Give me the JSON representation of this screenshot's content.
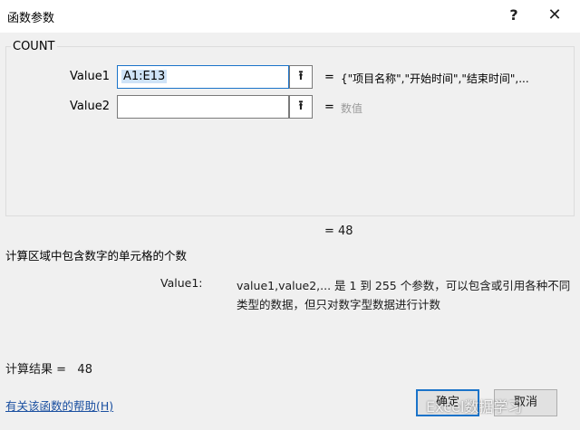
{
  "window": {
    "title": "函数参数",
    "help_glyph": "?",
    "close_glyph": "✕"
  },
  "function_name": "COUNT",
  "args": [
    {
      "label": "Value1",
      "value": "A1:E13",
      "preview": "{\"项目名称\",\"开始时间\",\"结束时间\",..."
    },
    {
      "label": "Value2",
      "value": "",
      "preview": "数值"
    }
  ],
  "equals_sign": "=",
  "collapse_glyph": "⭱",
  "formula_result": "= 48",
  "description": "计算区域中包含数字的单元格的个数",
  "param_help": {
    "name": "Value1:",
    "text": "value1,value2,... 是 1 到 255 个参数，可以包含或引用各种不同类型的数据，但只对数字型数据进行计数"
  },
  "calc_result": "计算结果 =   48",
  "help_link": "有关该函数的帮助(H)",
  "buttons": {
    "ok": "确定",
    "cancel": "取消"
  },
  "watermark": "Excel数据学习"
}
